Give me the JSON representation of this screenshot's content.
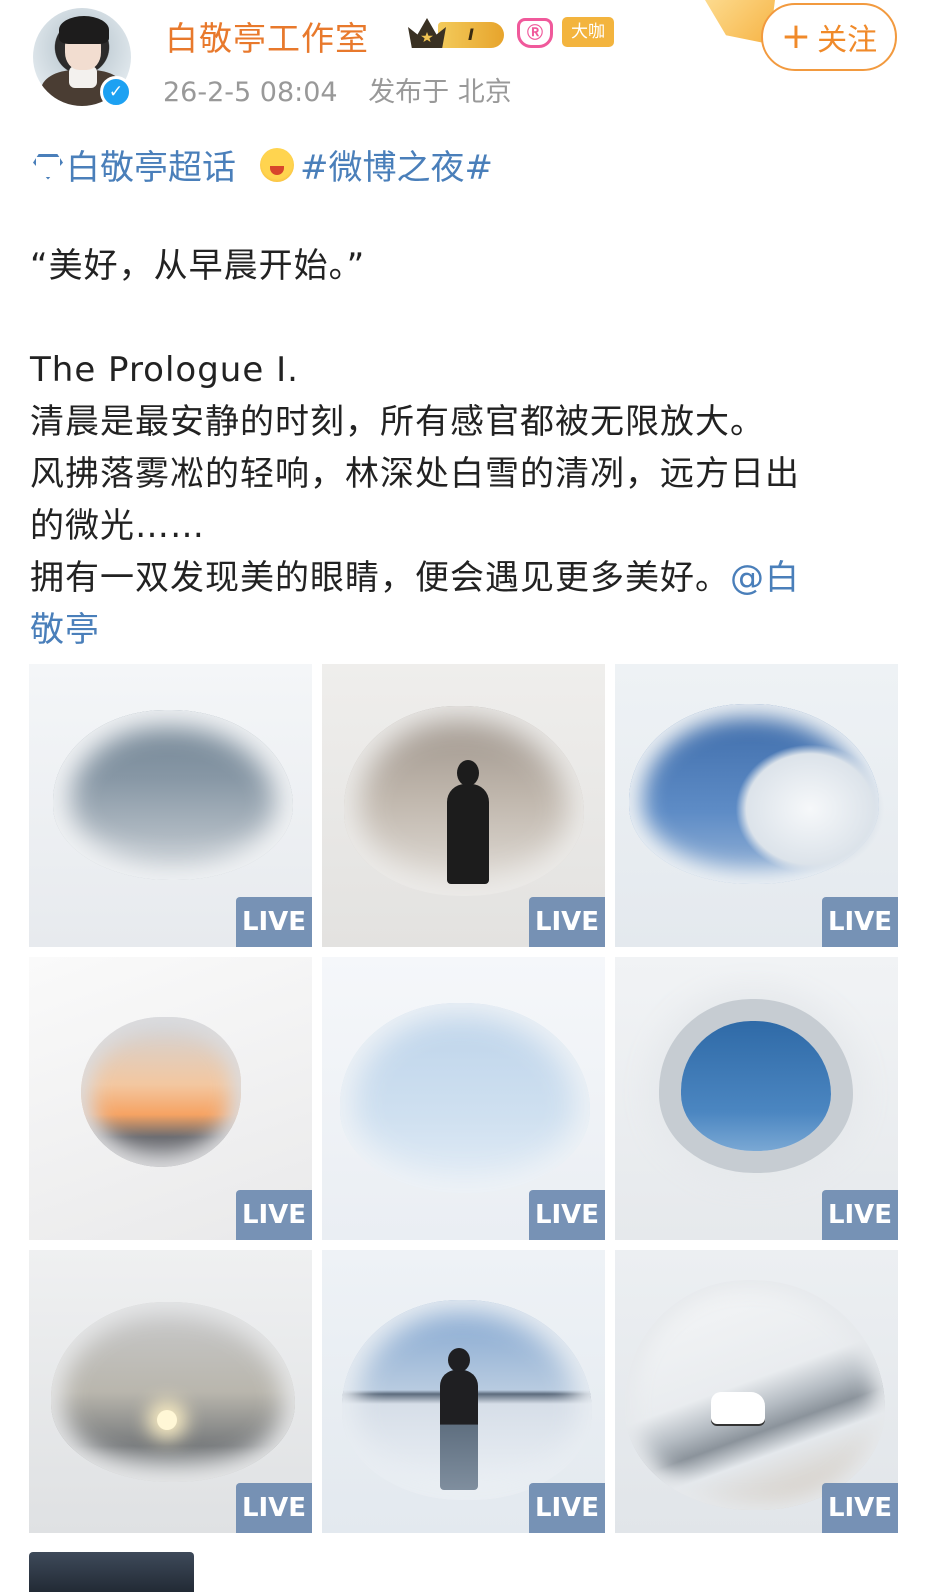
{
  "header": {
    "username": "白敬亭工作室",
    "level_badge": "I",
    "vip_icon": "Ⓡ",
    "vip_icon_name": "vip-badge-icon",
    "tag": "大咖",
    "follow_plus": "+",
    "follow_label": "关注",
    "timestamp": "26-2-5 08:04",
    "location": "发布于 北京",
    "verified_mark": "✓"
  },
  "topics": {
    "supertopic": "白敬亭超话",
    "hashtag": "#微博之夜#"
  },
  "post": {
    "line1": "“美好，从早晨开始。”",
    "line2": "The Prologue I.",
    "line3": "清晨是最安静的时刻，所有感官都被无限放大。",
    "line4": "风拂落雾凇的轻响，林深处白雪的清冽，远方日出",
    "line5": "的微光……",
    "line6": "拥有一双发现美的眼睛，便会遇见更多美好。",
    "mention_a": "@白",
    "mention_b": "敬亭"
  },
  "images": {
    "live_label": "LIVE",
    "count": 9
  },
  "colors": {
    "username": "#e8792c",
    "link": "#4a7fba",
    "meta": "#999999",
    "follow_border": "#f29a3f",
    "live_bg": "#6c8ab0"
  }
}
